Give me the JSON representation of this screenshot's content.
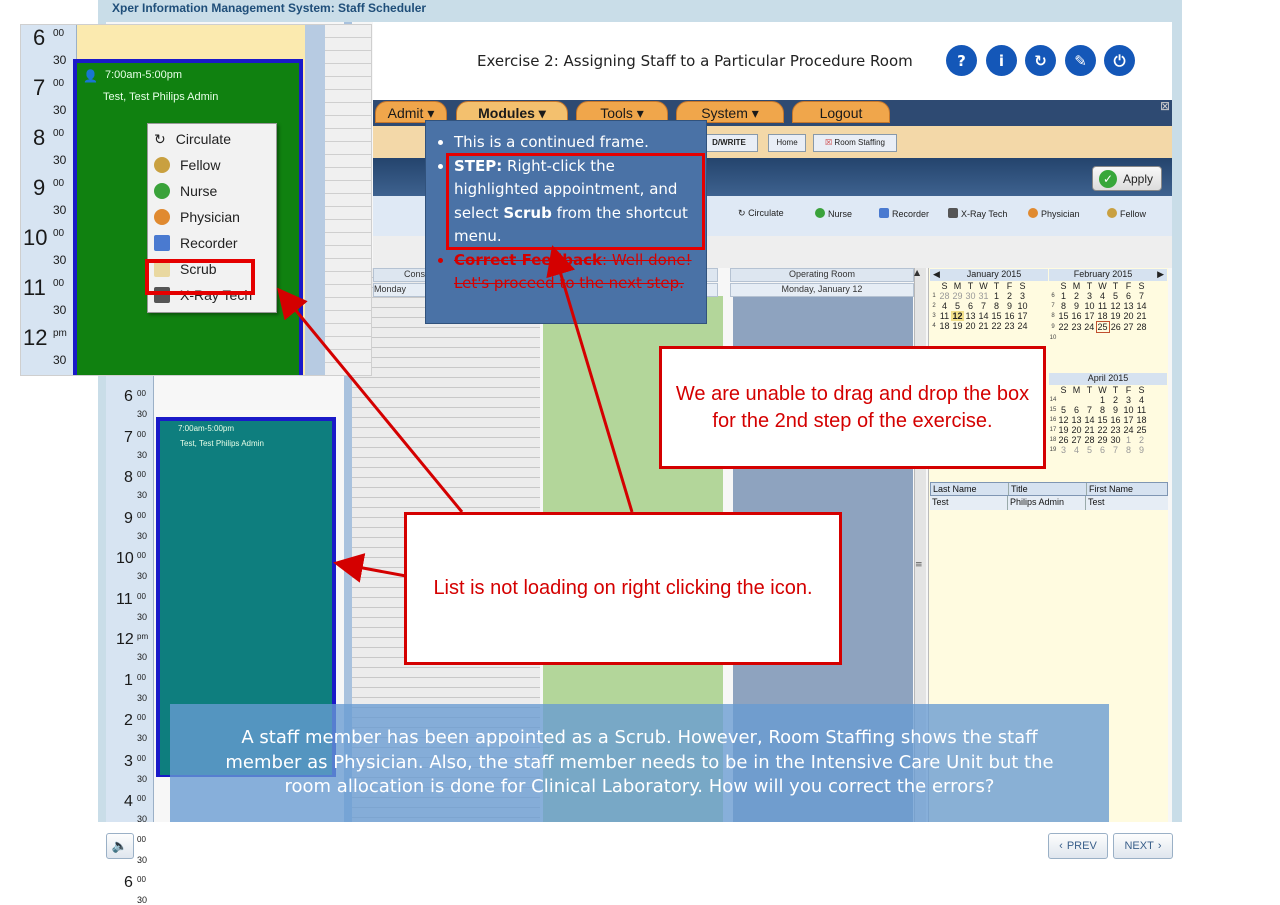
{
  "app_title": "Xper Information Management System: Staff Scheduler",
  "exercise_title": "Exercise 2: Assigning Staff to a Particular Procedure Room",
  "header_buttons": [
    {
      "icon": "help-icon",
      "glyph": "?"
    },
    {
      "icon": "info-icon",
      "glyph": "i"
    },
    {
      "icon": "refresh-icon",
      "glyph": "↻"
    },
    {
      "icon": "compass-icon",
      "glyph": "✎"
    },
    {
      "icon": "power-icon",
      "glyph": "⏻"
    }
  ],
  "nav_tabs": [
    "Admit",
    "Modules",
    "Tools",
    "System",
    "Logout"
  ],
  "sub_tabs": [
    "D/WRITE",
    "Home",
    "Room Staffing"
  ],
  "apply_label": "Apply",
  "staff_tools": [
    "Circulate",
    "Nurse",
    "Recorder",
    "X-Ray Tech",
    "Physician",
    "Fellow"
  ],
  "columns": {
    "col1_header": "Cons",
    "col1_date": "Monday",
    "col2_header": "Operating Room",
    "col2_date": "Monday, January 12"
  },
  "calendars": [
    {
      "month": "January 2015"
    },
    {
      "month": "February 2015"
    },
    {
      "month": "April 2015"
    }
  ],
  "day_letters": [
    "S",
    "M",
    "T",
    "W",
    "T",
    "F",
    "S"
  ],
  "staff_table": {
    "headers": [
      "Last Name",
      "Title",
      "First Name"
    ],
    "rows": [
      [
        "Test",
        "Philips Admin",
        "Test"
      ]
    ]
  },
  "schedule": {
    "appt_time": "7:00am-5:00pm",
    "appt_name": "Test, Test Philips Admin",
    "hours": [
      {
        "hour": "6",
        "sup": "00"
      },
      {
        "hour": "7",
        "sup": "00"
      },
      {
        "hour": "8",
        "sup": "00"
      },
      {
        "hour": "9",
        "sup": "00"
      },
      {
        "hour": "10",
        "sup": "00"
      },
      {
        "hour": "11",
        "sup": "00"
      },
      {
        "hour": "12",
        "sup": "pm"
      },
      {
        "hour": "1",
        "sup": "00"
      },
      {
        "hour": "2",
        "sup": "00"
      },
      {
        "hour": "3",
        "sup": "00"
      },
      {
        "hour": "4",
        "sup": "00"
      },
      {
        "hour": "5",
        "sup": "00"
      },
      {
        "hour": "6",
        "sup": "00"
      }
    ],
    "half": "30"
  },
  "inset": {
    "appt_time": "7:00am-5:00pm",
    "appt_name": "Test, Test Philips Admin",
    "hours": [
      {
        "hour": "6",
        "sup": "00"
      },
      {
        "hour": "7",
        "sup": "00"
      },
      {
        "hour": "8",
        "sup": "00"
      },
      {
        "hour": "9",
        "sup": "00"
      },
      {
        "hour": "10",
        "sup": "00"
      },
      {
        "hour": "11",
        "sup": "00"
      },
      {
        "hour": "12",
        "sup": "pm"
      }
    ],
    "menu_items": [
      "Circulate",
      "Fellow",
      "Nurse",
      "Physician",
      "Recorder",
      "Scrub",
      "X-Ray Tech"
    ]
  },
  "instructions": {
    "line1": "This is a continued frame.",
    "step_label": "STEP:",
    "step_text_a": " Right-click the highlighted appointment, and select ",
    "step_bold": "Scrub",
    "step_text_b": " from the shortcut menu.",
    "feedback_label": "Correct Feedback",
    "feedback_text": ": Well done! Let's proceed to the next step."
  },
  "annotations": {
    "drag": "We are unable to drag and drop the box for the 2nd step of the exercise.",
    "list": "List is not loading on right clicking the icon."
  },
  "question": "A staff member has been appointed as a Scrub. However, Room Staffing shows the staff member as Physician. Also, the staff member needs to be in the Intensive Care Unit but the room allocation is done for Clinical Laboratory. How will you correct the errors?",
  "footer": {
    "prev_label": "PREV",
    "next_label": "NEXT"
  },
  "colors": {
    "annotation_red": "#d40000",
    "header_button_blue": "#1457b8",
    "appointment_teal": "#0e7e7e",
    "inset_appointment_green": "#108110"
  }
}
